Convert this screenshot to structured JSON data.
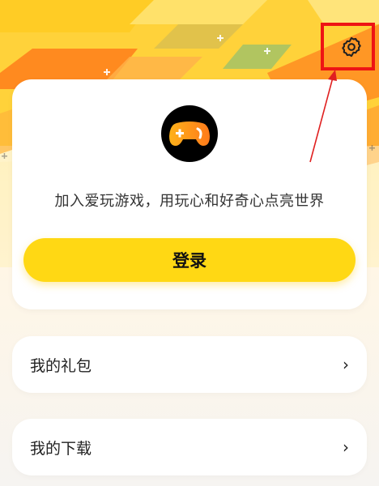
{
  "header": {
    "settings_icon": "gear-icon",
    "highlight_color": "#ee1414"
  },
  "profile_card": {
    "logo_icon": "gamepad-icon",
    "slogan": "加入爱玩游戏，用玩心和好奇心点亮世界",
    "login_label": "登录"
  },
  "menu": {
    "items": [
      {
        "label": "我的礼包",
        "chevron": "›"
      },
      {
        "label": "我的下载",
        "chevron": "›"
      }
    ]
  },
  "colors": {
    "accent": "#ffd814",
    "banner_yellow": "#ffd23a",
    "banner_orange": "#ff8a1f"
  }
}
